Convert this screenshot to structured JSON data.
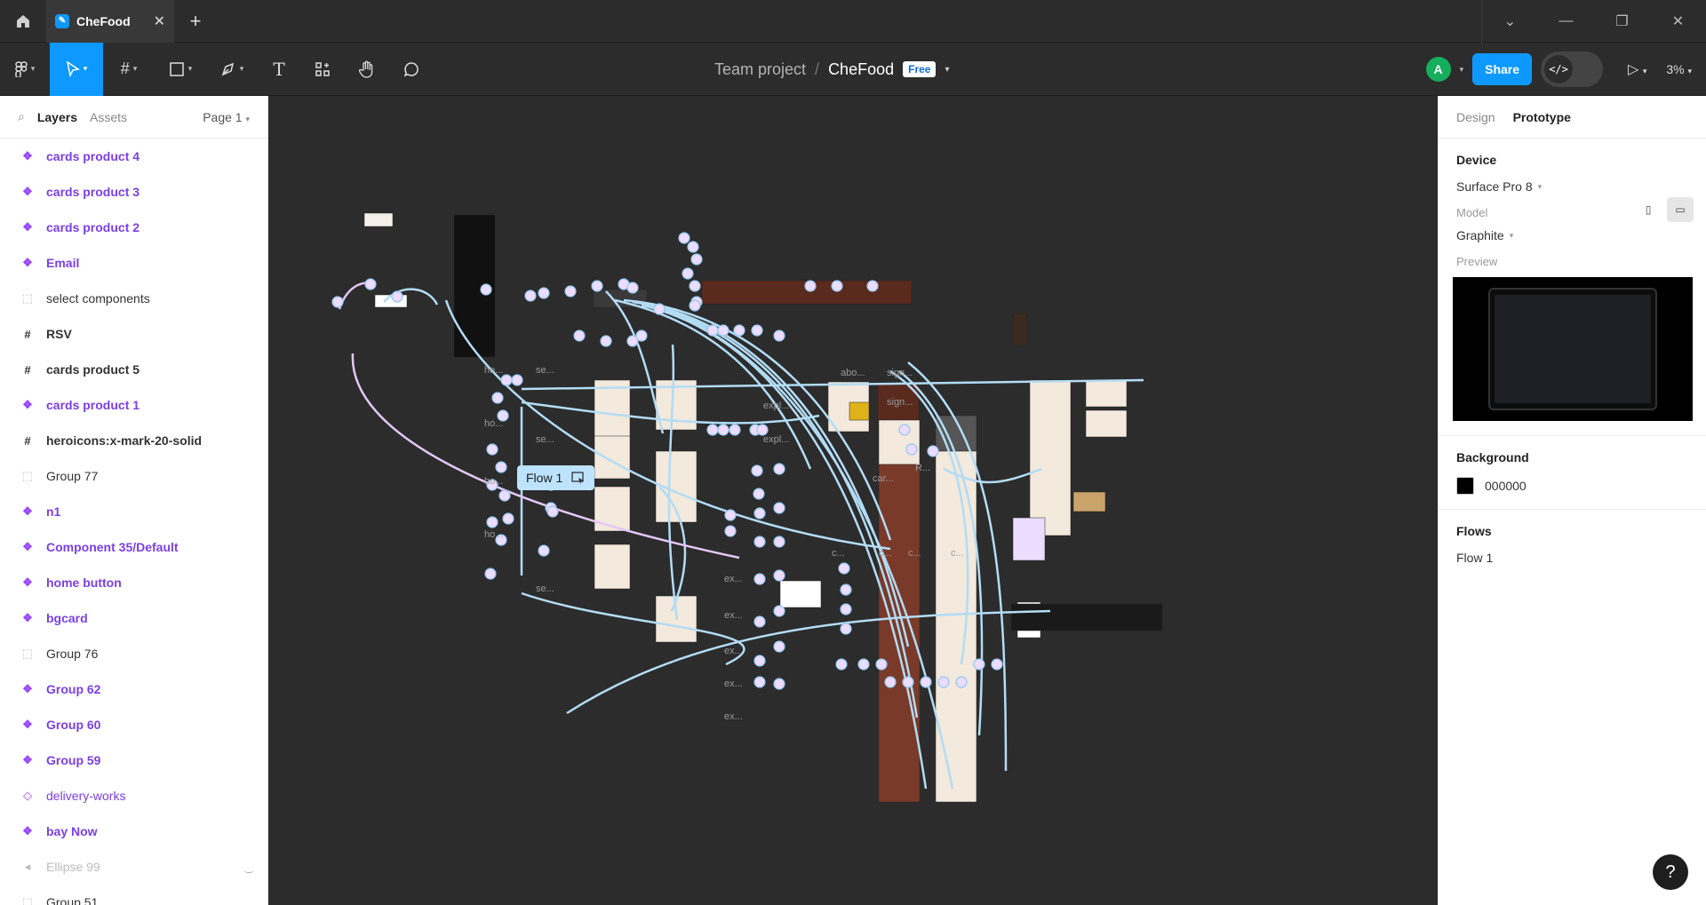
{
  "window": {
    "tab_title": "CheFood",
    "new_tab": "+",
    "home_icon": "home-icon",
    "controls": [
      "chevron-down-icon",
      "minimize-icon",
      "restore-icon",
      "close-icon"
    ]
  },
  "toolbar": {
    "tools": [
      "figma-menu-icon",
      "move-icon",
      "frame-icon",
      "rectangle-icon",
      "pen-icon",
      "text-icon",
      "resources-icon",
      "hand-icon",
      "comment-icon"
    ],
    "breadcrumb": {
      "team": "Team project",
      "separator": "/",
      "file": "CheFood",
      "plan_badge": "Free"
    },
    "avatar_initial": "A",
    "avatar_color": "#14ae5c",
    "share_label": "Share",
    "zoom": "3%"
  },
  "left_panel": {
    "tabs": {
      "layers": "Layers",
      "assets": "Assets",
      "page": "Page 1"
    },
    "layers": [
      {
        "name": "cards product 4",
        "kind": "component"
      },
      {
        "name": "cards product 3",
        "kind": "component"
      },
      {
        "name": "cards product 2",
        "kind": "component"
      },
      {
        "name": "Email",
        "kind": "component"
      },
      {
        "name": "select components",
        "kind": "group"
      },
      {
        "name": "RSV",
        "kind": "frame"
      },
      {
        "name": "cards product 5",
        "kind": "frame"
      },
      {
        "name": "cards product 1",
        "kind": "component"
      },
      {
        "name": "heroicons:x-mark-20-solid",
        "kind": "frame"
      },
      {
        "name": "Group 77",
        "kind": "group"
      },
      {
        "name": "n1",
        "kind": "component"
      },
      {
        "name": "Component 35/Default",
        "kind": "component"
      },
      {
        "name": "home button",
        "kind": "component"
      },
      {
        "name": "bgcard",
        "kind": "component"
      },
      {
        "name": "Group 76",
        "kind": "group"
      },
      {
        "name": "Group 62",
        "kind": "component"
      },
      {
        "name": "Group 60",
        "kind": "component"
      },
      {
        "name": "Group 59",
        "kind": "component"
      },
      {
        "name": "delivery-works",
        "kind": "instance"
      },
      {
        "name": "bay Now",
        "kind": "component"
      },
      {
        "name": "Ellipse 99",
        "kind": "hidden"
      },
      {
        "name": "Group 51",
        "kind": "group"
      }
    ]
  },
  "canvas": {
    "flow_label": "Flow 1",
    "background": "#2c2c2c",
    "connector_color": "#b3dcf5",
    "node_color": "#ecdcff",
    "frame_labels": [
      "ho...",
      "se...",
      "ho...",
      "se...",
      "ho...",
      "ho...",
      "se...",
      "expl...",
      "expl...",
      "abo...",
      "sign...",
      "sign...",
      "R...",
      "car...",
      "c...",
      "c...",
      "c...",
      "c...",
      "ex...",
      "ex...",
      "ex...",
      "ex...",
      "ex..."
    ]
  },
  "right_panel": {
    "tabs": {
      "design": "Design",
      "prototype": "Prototype"
    },
    "device": {
      "heading": "Device",
      "value": "Surface Pro 8"
    },
    "model": {
      "label": "Model",
      "value": "Graphite"
    },
    "preview": {
      "label": "Preview"
    },
    "background": {
      "heading": "Background",
      "color": "#000000",
      "hex_label": "000000"
    },
    "flows": {
      "heading": "Flows",
      "items": [
        "Flow 1"
      ]
    }
  },
  "help": "?"
}
